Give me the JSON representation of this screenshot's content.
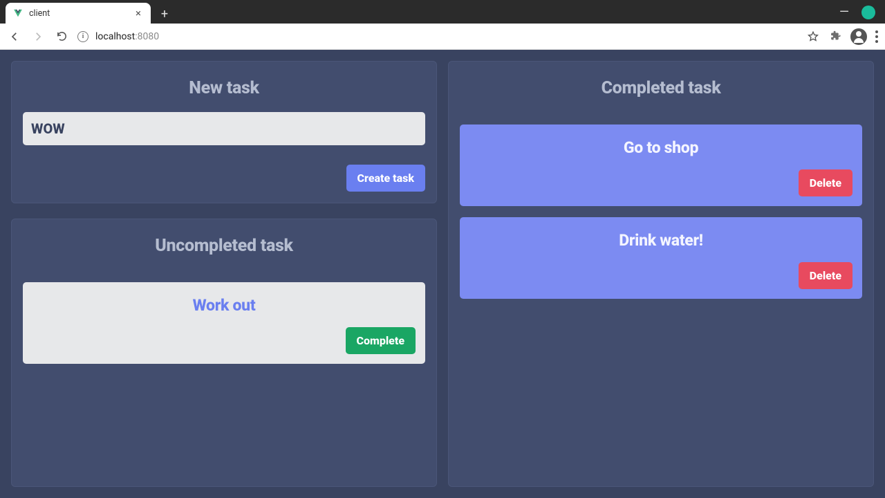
{
  "browser": {
    "tab_title": "client",
    "url_host": "localhost",
    "url_port": ":8080"
  },
  "panels": {
    "new_task_title": "New task",
    "uncompleted_title": "Uncompleted task",
    "completed_title": "Completed task"
  },
  "new_task": {
    "input_value": "WOW",
    "create_label": "Create task"
  },
  "uncompleted": [
    {
      "title": "Work out",
      "action_label": "Complete"
    }
  ],
  "completed": [
    {
      "title": "Go to shop",
      "action_label": "Delete"
    },
    {
      "title": "Drink water!",
      "action_label": "Delete"
    }
  ],
  "colors": {
    "bg": "#394360",
    "panel": "#424d6e",
    "accent": "#6a7ff0",
    "success": "#1aa664",
    "danger": "#e84a5f"
  }
}
